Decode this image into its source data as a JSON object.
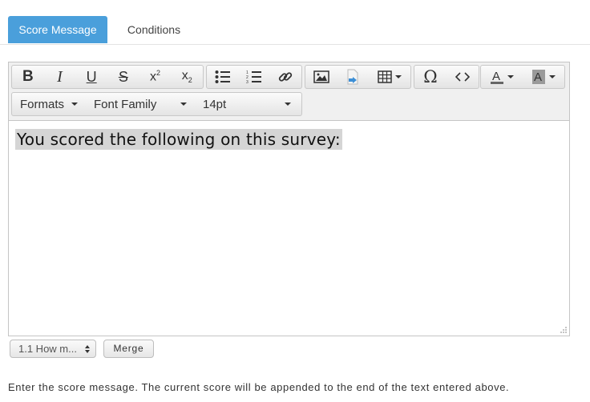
{
  "tabs": [
    {
      "label": "Score Message",
      "active": true
    },
    {
      "label": "Conditions",
      "active": false
    }
  ],
  "toolbar": {
    "row2": {
      "formats_label": "Formats",
      "font_family_label": "Font Family",
      "font_size_label": "14pt"
    }
  },
  "editor": {
    "content_text": "You scored the following on this survey: "
  },
  "merge_controls": {
    "select_value": "1.1 How m...",
    "merge_label": "Merge"
  },
  "help_text": "Enter the score message. The current score will be appended to the end of the text entered above.",
  "colors": {
    "accent": "#4a9fdb",
    "highlight": "#d5d5d5"
  }
}
